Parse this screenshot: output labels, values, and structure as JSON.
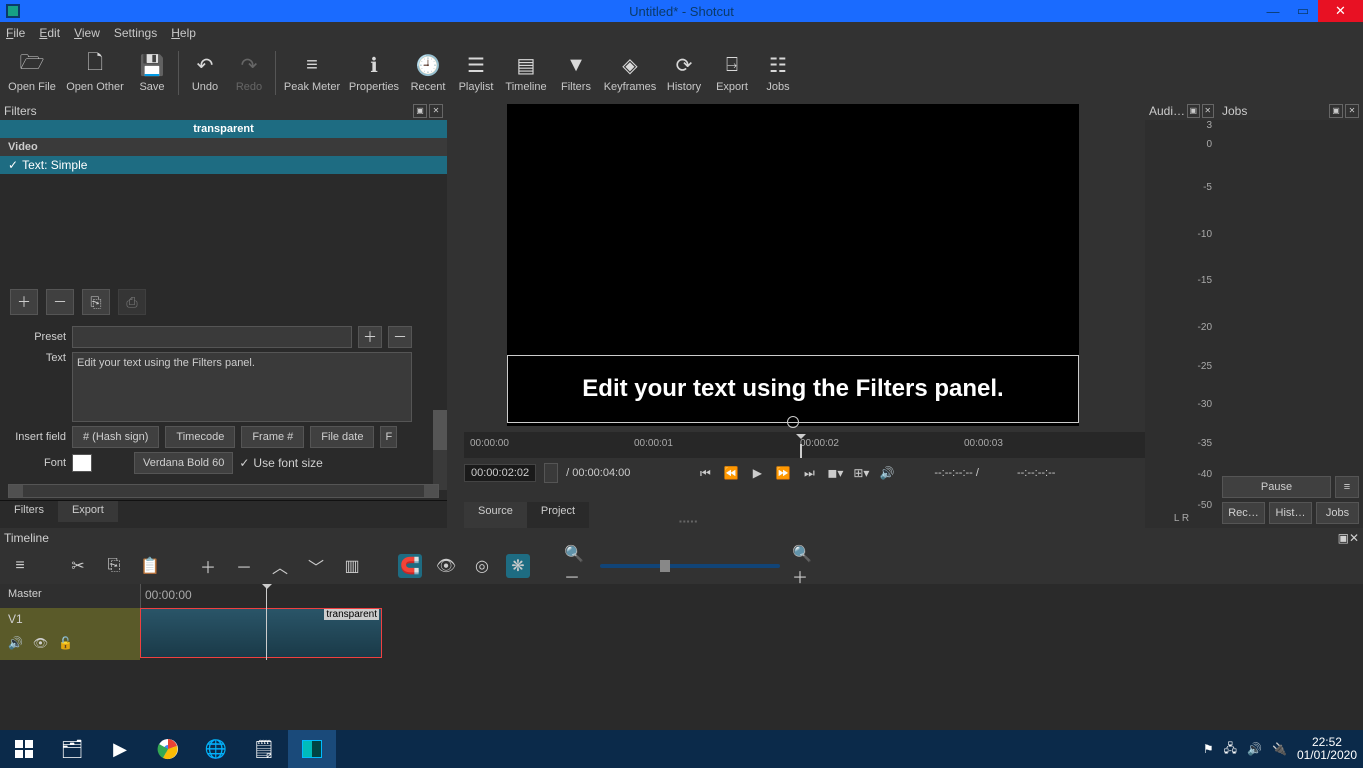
{
  "window": {
    "title": "Untitled* - Shotcut"
  },
  "menu": {
    "file": "File",
    "edit": "Edit",
    "view": "View",
    "settings": "Settings",
    "help": "Help"
  },
  "toolbar": {
    "open": "Open File",
    "open_other": "Open Other",
    "save": "Save",
    "undo": "Undo",
    "redo": "Redo",
    "peak": "Peak Meter",
    "properties": "Properties",
    "recent": "Recent",
    "playlist": "Playlist",
    "timeline": "Timeline",
    "filters": "Filters",
    "keyframes": "Keyframes",
    "history": "History",
    "export": "Export",
    "jobs": "Jobs"
  },
  "filters_panel": {
    "title": "Filters",
    "clip": "transparent",
    "category": "Video",
    "filter_name": "Text: Simple",
    "preset_label": "Preset",
    "text_label": "Text",
    "text_value": "Edit your text using the Filters panel.",
    "insert_label": "Insert field",
    "btn_hash": "# (Hash sign)",
    "btn_timecode": "Timecode",
    "btn_frame": "Frame #",
    "btn_filedate": "File date",
    "btn_more": "F",
    "font_label": "Font",
    "font_name": "Verdana Bold 60",
    "use_font_size": "Use font size",
    "tab_filters": "Filters",
    "tab_export": "Export"
  },
  "preview": {
    "overlay_text": "Edit your text using the Filters panel.",
    "ruler": [
      "00:00:00",
      "00:00:01",
      "00:00:02",
      "00:00:03"
    ],
    "tc_current": "00:00:02:02",
    "tc_total": "/ 00:00:04:00",
    "tc_in": "--:--:--:-- /",
    "tc_out": "--:--:--:--",
    "tab_source": "Source",
    "tab_project": "Project"
  },
  "audio": {
    "title": "Audi…",
    "ticks": [
      "3",
      "0",
      "-5",
      "-10",
      "-15",
      "-20",
      "-25",
      "-30",
      "-35",
      "-40",
      "-50"
    ],
    "lr": "L   R"
  },
  "jobs": {
    "title": "Jobs",
    "pause": "Pause",
    "menu": "≡",
    "rec": "Rec…",
    "hist": "Hist…",
    "jobs": "Jobs"
  },
  "timeline": {
    "title": "Timeline",
    "master": "Master",
    "v1": "V1",
    "ruler0": "00:00:00",
    "clip": "transparent"
  },
  "taskbar": {
    "time": "22:52",
    "date": "01/01/2020"
  }
}
